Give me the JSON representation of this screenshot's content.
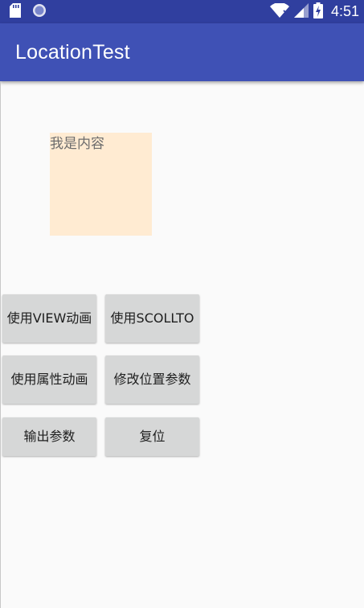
{
  "status_bar": {
    "time": "4:51",
    "left_icons": [
      "sd-card-icon",
      "sync-circle-icon"
    ],
    "right_icons": [
      "wifi-icon",
      "signal-icon",
      "battery-charging-icon"
    ]
  },
  "app_bar": {
    "title": "LocationTest"
  },
  "content": {
    "text": "我是内容"
  },
  "buttons": {
    "view_anim": "使用VIEW动画",
    "scrollto": "使用SCOLLTO",
    "property_anim": "使用属性动画",
    "modify_params": "修改位置参数",
    "output_params": "输出参数",
    "reset": "复位"
  },
  "colors": {
    "status_bar": "#303f9f",
    "app_bar": "#3f51b5",
    "background": "#fafafa",
    "content_box": "#ffebd2",
    "button": "#d6d7d7"
  }
}
